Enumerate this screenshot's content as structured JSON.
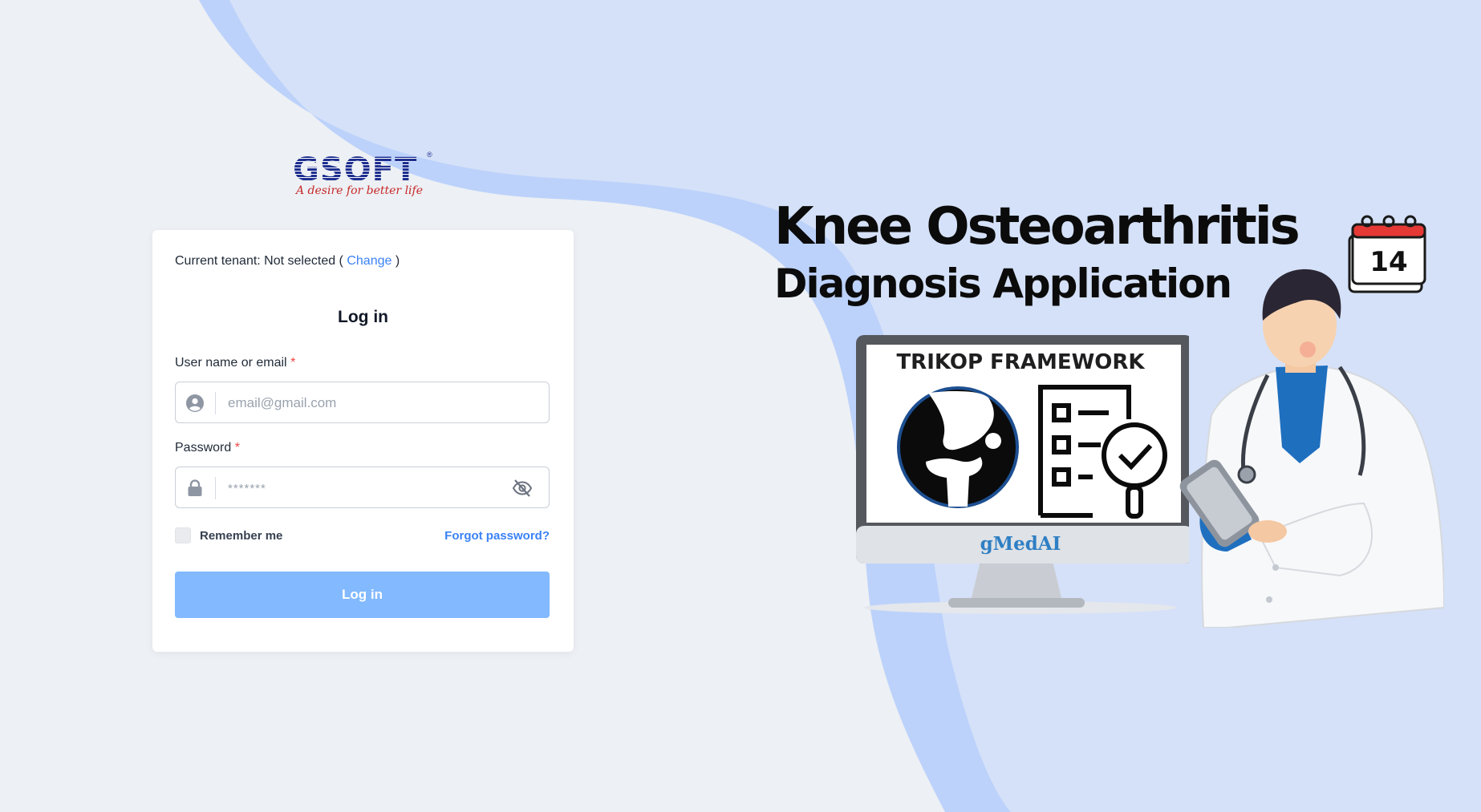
{
  "colors": {
    "page_bg": "#edf0f4",
    "hero_bg": "#d5e1f8",
    "swoosh": "#bcd2fb",
    "accent": "#3b82f6",
    "login_button": "#82b9ff",
    "logo_blue": "#1e2f8f",
    "logo_red": "#c62828"
  },
  "logo": {
    "word": "GSOFT",
    "registered": "®",
    "tagline": "A desire for better life"
  },
  "login": {
    "tenant_prefix": "Current tenant: Not selected (",
    "tenant_change": "Change",
    "tenant_suffix": ")",
    "title": "Log in",
    "username_label": "User name or email",
    "required_mark": "*",
    "username_placeholder": "email@gmail.com",
    "username_icon": "user-circle-icon",
    "password_label": "Password",
    "password_value": "*******",
    "password_icon": "lock-icon",
    "password_toggle_icon": "eye-off-icon",
    "remember_label": "Remember me",
    "remember_checked": false,
    "forgot_label": "Forgot password?",
    "submit_label": "Log in"
  },
  "hero": {
    "title_line1": "Knee Osteoarthritis",
    "title_line2": "Diagnosis Application",
    "monitor_header": "TRIKOP FRAMEWORK",
    "monitor_brand": "gMedAI",
    "calendar_day": "14"
  }
}
